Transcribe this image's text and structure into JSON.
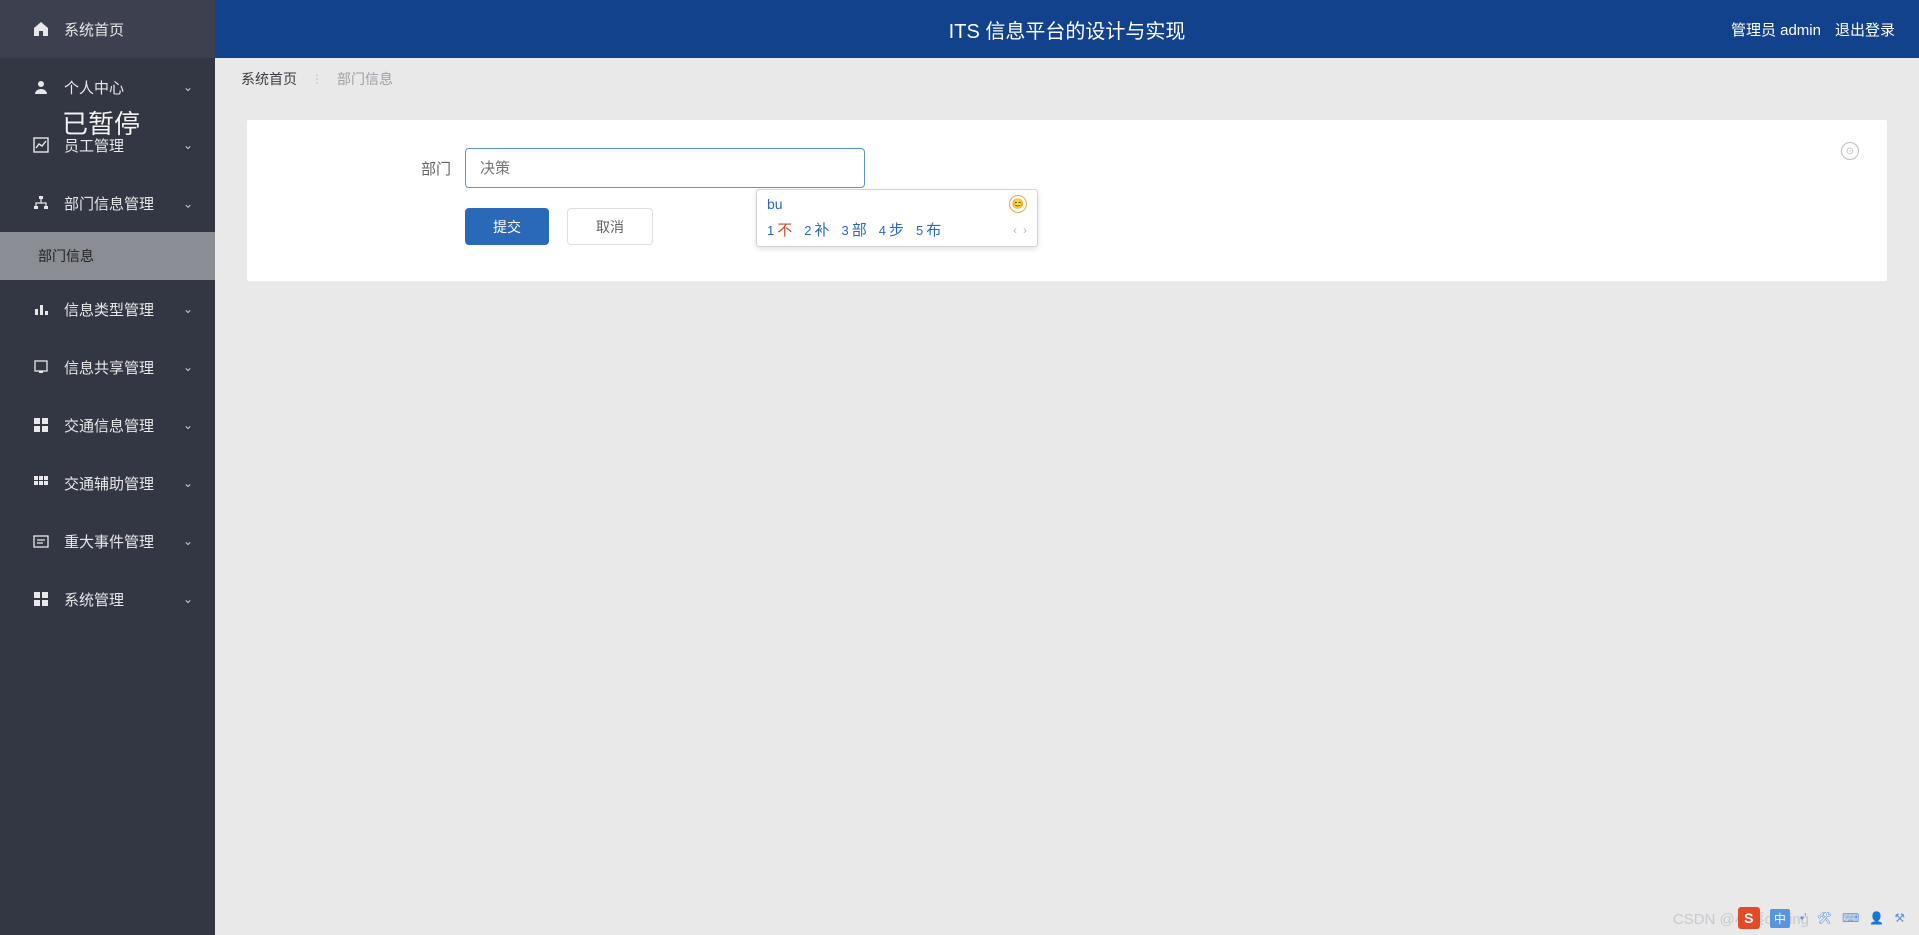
{
  "header": {
    "title": "ITS 信息平台的设计与实现",
    "user_label": "管理员 admin",
    "logout": "退出登录"
  },
  "overlay": {
    "paused": "已暂停"
  },
  "sidebar": {
    "items": [
      {
        "icon": "home",
        "label": "系统首页",
        "expandable": false
      },
      {
        "icon": "user",
        "label": "个人中心",
        "expandable": true,
        "expanded": false
      },
      {
        "icon": "chart",
        "label": "员工管理",
        "expandable": true,
        "expanded": false
      },
      {
        "icon": "tree",
        "label": "部门信息管理",
        "expandable": true,
        "expanded": true,
        "children": [
          {
            "label": "部门信息"
          }
        ]
      },
      {
        "icon": "bar",
        "label": "信息类型管理",
        "expandable": true,
        "expanded": false
      },
      {
        "icon": "share",
        "label": "信息共享管理",
        "expandable": true,
        "expanded": false
      },
      {
        "icon": "grid",
        "label": "交通信息管理",
        "expandable": true,
        "expanded": false
      },
      {
        "icon": "grid2",
        "label": "交通辅助管理",
        "expandable": true,
        "expanded": false
      },
      {
        "icon": "event",
        "label": "重大事件管理",
        "expandable": true,
        "expanded": false
      },
      {
        "icon": "gear",
        "label": "系统管理",
        "expandable": true,
        "expanded": false
      }
    ]
  },
  "breadcrumb": {
    "home": "系统首页",
    "current": "部门信息"
  },
  "form": {
    "dept_label": "部门",
    "dept_placeholder": "决策",
    "submit": "提交",
    "cancel": "取消"
  },
  "ime": {
    "buffer": "bu",
    "candidates": [
      {
        "n": "1",
        "c": "不"
      },
      {
        "n": "2",
        "c": "补"
      },
      {
        "n": "3",
        "c": "部"
      },
      {
        "n": "4",
        "c": "步"
      },
      {
        "n": "5",
        "c": "布"
      }
    ]
  },
  "taskbar": {
    "zh": "中",
    "watermark": "CSDN @小蔡coding"
  }
}
